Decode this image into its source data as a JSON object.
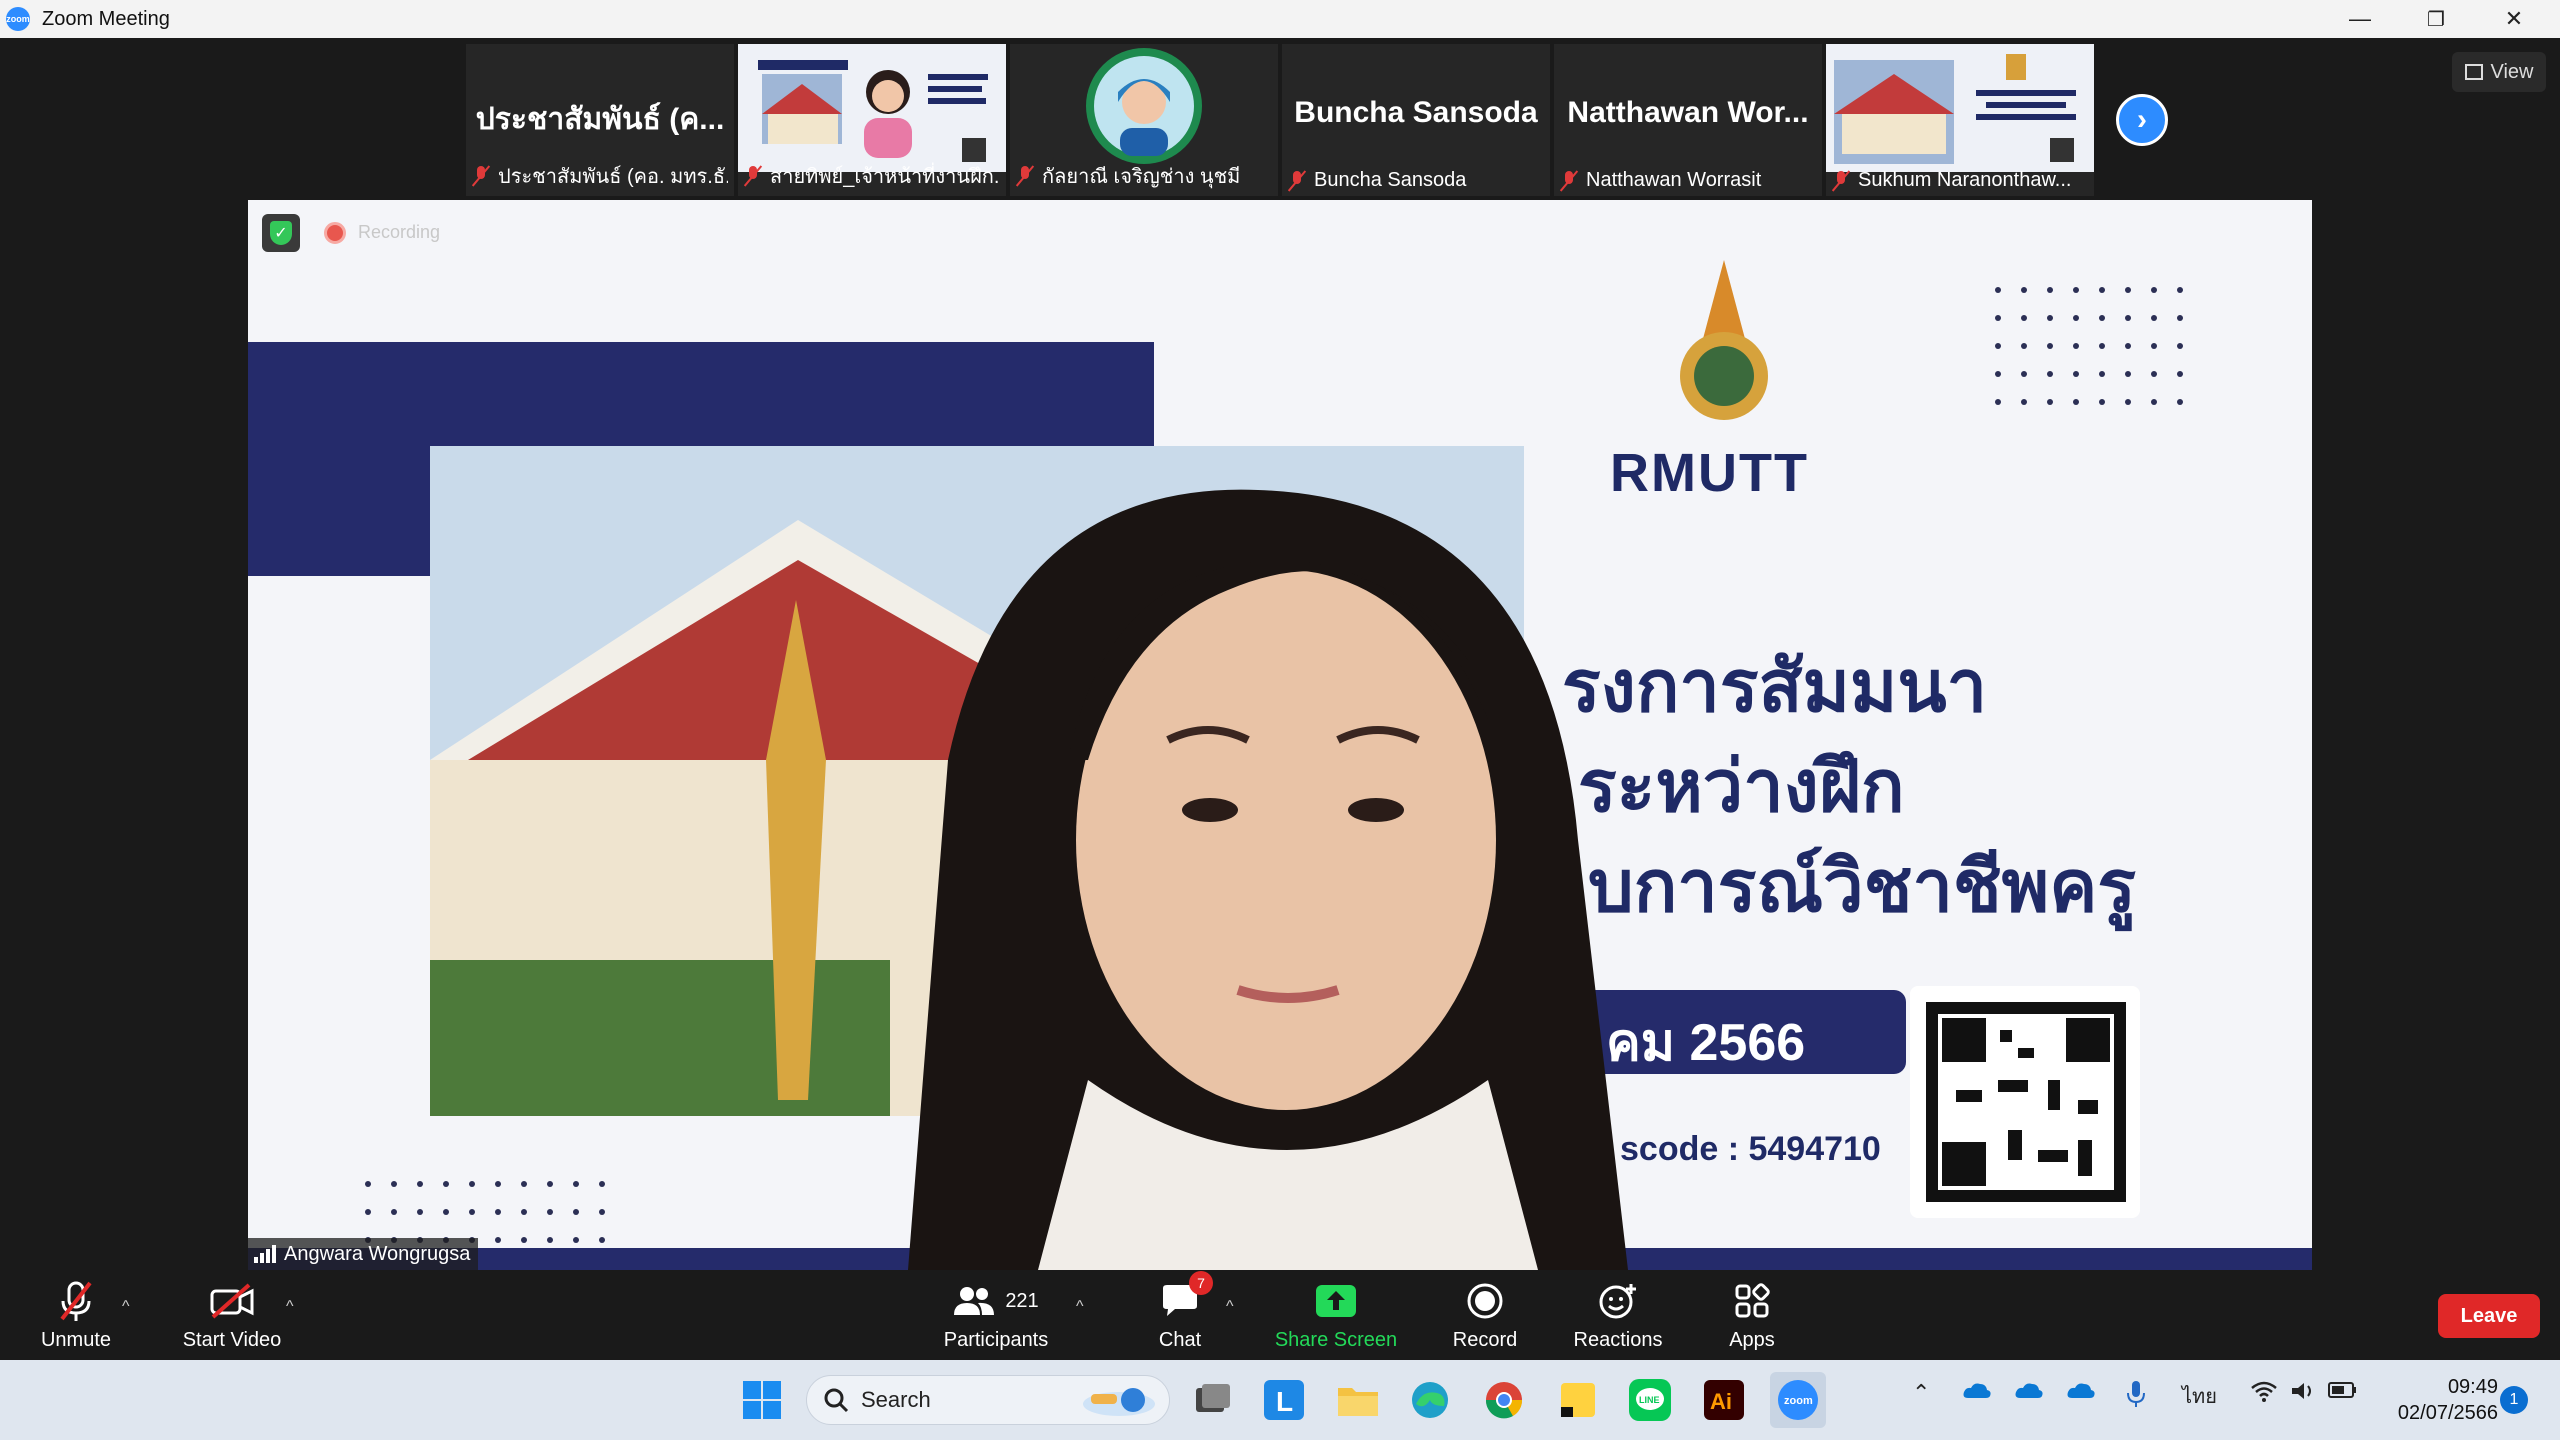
{
  "window": {
    "title": "Zoom Meeting",
    "minimize": "—",
    "restore": "❐",
    "close": "✕"
  },
  "thumbnails": [
    {
      "big_name": "ประชาสัมพันธ์ (ค...",
      "caption": "ประชาสัมพันธ์ (คอ. มทร.ธั..."
    },
    {
      "big_name": "",
      "caption": "สายทิพย์_เจ้าหน้าที่งานฝึก..."
    },
    {
      "big_name": "",
      "caption": "กัลยาณี เจริญช่าง นุชมี"
    },
    {
      "big_name": "Buncha Sansoda",
      "caption": "Buncha Sansoda"
    },
    {
      "big_name": "Natthawan  Wor...",
      "caption": "Natthawan Worrasit"
    },
    {
      "big_name": "",
      "caption": "Sukhum Naranonthaw..."
    }
  ],
  "view_label": "View",
  "next_arrow": "›",
  "recording_label": "Recording",
  "speaker_name": "Angwara Wongrugsa",
  "slide": {
    "logo_text": "RMUTT",
    "line1": "รงการสัมมนา",
    "line2": "ระหว่างฝึก",
    "line3": "บการณ์วิชาชีพครู",
    "date_fragment": "คม 2566",
    "passcode": "scode : 5494710"
  },
  "toolbar": {
    "unmute": "Unmute",
    "start_video": "Start Video",
    "participants": "Participants",
    "participants_count": "221",
    "chat": "Chat",
    "chat_badge": "7",
    "share_screen": "Share Screen",
    "record": "Record",
    "reactions": "Reactions",
    "apps": "Apps",
    "leave": "Leave",
    "caret": "^"
  },
  "taskbar": {
    "search": "Search",
    "time": "09:49",
    "date": "02/07/2566",
    "language": "ไทย",
    "notification_count": "1"
  },
  "colors": {
    "zoom_blue": "#2d8cff",
    "leave_red": "#e02828",
    "share_green": "#23d959",
    "slide_navy": "#1f2a66"
  }
}
